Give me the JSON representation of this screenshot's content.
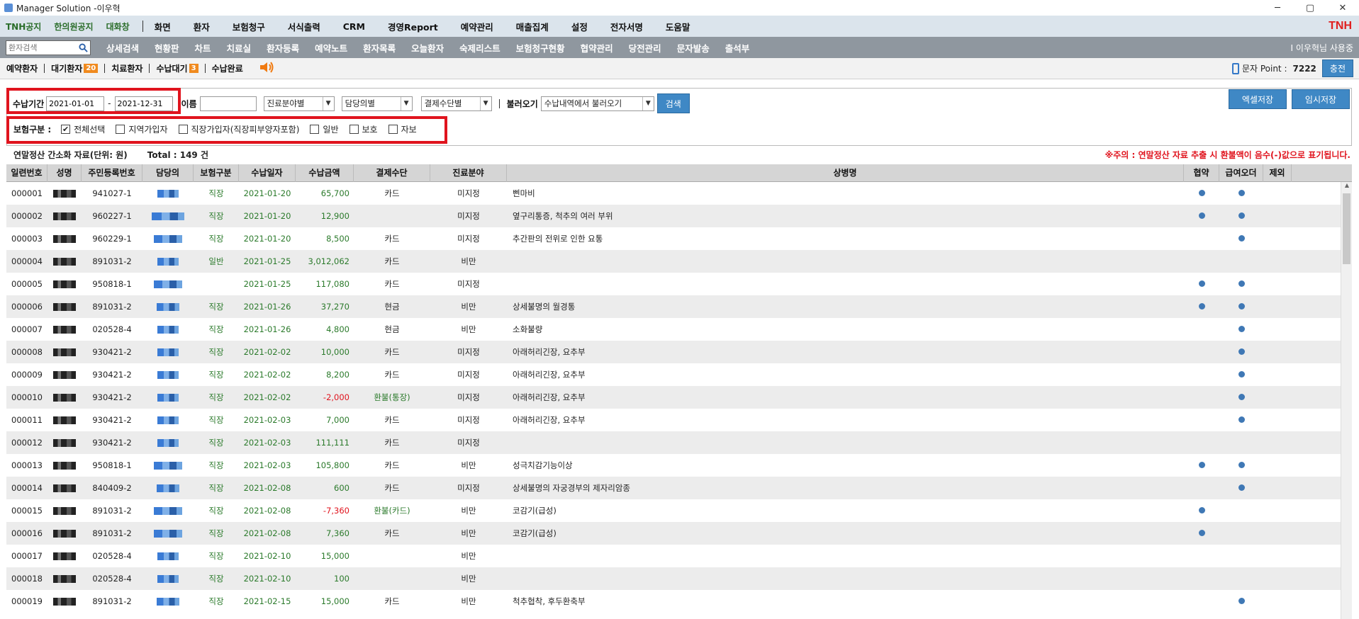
{
  "window": {
    "title": "Manager Solution -이우혁",
    "controls": [
      "─",
      "▢",
      "✕"
    ]
  },
  "menubar": {
    "notices": [
      "TNH공지",
      "한의원공지",
      "대화창"
    ],
    "menus": [
      "화면",
      "환자",
      "보험청구",
      "서식출력",
      "CRM",
      "경영Report",
      "예약관리",
      "매출집계",
      "설정",
      "전자서명",
      "도움말"
    ],
    "brand": "TNH",
    "brand_color": "#e02020"
  },
  "navbar": {
    "search_placeholder": "환자검색",
    "items": [
      "상세검색",
      "현황판",
      "차트",
      "치료실",
      "환자등록",
      "예약노트",
      "환자목록",
      "오늘환자",
      "숙제리스트",
      "보험청구현황",
      "협약관리",
      "당전관리",
      "문자발송",
      "출석부"
    ],
    "user": "I 이우혁님 사용중"
  },
  "statusbar": {
    "items": [
      {
        "label": "예약환자"
      },
      {
        "label": "대기환자",
        "badge": "20"
      },
      {
        "label": "치료환자"
      },
      {
        "label": "수납대기",
        "badge": "3"
      },
      {
        "label": "수납완료"
      }
    ],
    "point_label": "문자 Point :",
    "point_value": "7222",
    "charge_label": "충전"
  },
  "filters": {
    "period_label": "수납기간",
    "date_from": "2021-01-01",
    "date_sep": "-",
    "date_to": "2021-12-31",
    "name_label": "이름",
    "name_value": "",
    "select_dept": "진료분야별",
    "select_doctor": "담당의별",
    "select_payment": "결제수단별",
    "load_label": "불러오기",
    "select_load": "수납내역에서 불러오기",
    "search_btn": "검색",
    "excel_btn": "엑셀저장",
    "temp_btn": "임시저장",
    "insurance_label": "보험구분 :",
    "checkboxes": [
      {
        "label": "전체선택",
        "checked": true
      },
      {
        "label": "지역가입자",
        "checked": false
      },
      {
        "label": "직장가입자(직장피부양자포함)",
        "checked": false
      },
      {
        "label": "일반",
        "checked": false
      },
      {
        "label": "보호",
        "checked": false
      },
      {
        "label": "자보",
        "checked": false
      }
    ]
  },
  "info": {
    "title": "연말정산 간소화 자료(단위: 원)",
    "total": "Total : 149 건",
    "warning": "※주의 : 연말정산 자료 추출 시 환불액이 음수(-)값으로 표기됩니다."
  },
  "table": {
    "headers": [
      "일련번호",
      "성명",
      "주민등록번호",
      "담당의",
      "보험구분",
      "수납일자",
      "수납금액",
      "결제수단",
      "진료분야",
      "상병명",
      "협약",
      "급여오더",
      "제외"
    ],
    "rows": [
      {
        "no": "000001",
        "rrn": "941027-1",
        "doc_w": 30,
        "ins": "직장",
        "date": "2021-01-20",
        "amt": "65,700",
        "neg": false,
        "pay": "카드",
        "field": "미지정",
        "dx": "삔마비",
        "a": true,
        "b": true
      },
      {
        "no": "000002",
        "rrn": "960227-1",
        "doc_w": 46,
        "ins": "직장",
        "date": "2021-01-20",
        "amt": "12,900",
        "neg": false,
        "pay": "",
        "field": "미지정",
        "dx": "옆구리통증, 척추의 여러 부위",
        "a": true,
        "b": true
      },
      {
        "no": "000003",
        "rrn": "960229-1",
        "doc_w": 40,
        "ins": "직장",
        "date": "2021-01-20",
        "amt": "8,500",
        "neg": false,
        "pay": "카드",
        "field": "미지정",
        "dx": "추간판의 전위로 인한 요통",
        "a": false,
        "b": true
      },
      {
        "no": "000004",
        "rrn": "891031-2",
        "doc_w": 30,
        "ins": "일반",
        "date": "2021-01-25",
        "amt": "3,012,062",
        "neg": false,
        "pay": "카드",
        "field": "비만",
        "dx": "",
        "a": false,
        "b": false
      },
      {
        "no": "000005",
        "rrn": "950818-1",
        "doc_w": 40,
        "ins": "",
        "date": "2021-01-25",
        "amt": "117,080",
        "neg": false,
        "pay": "카드",
        "field": "미지정",
        "dx": "",
        "a": true,
        "b": true
      },
      {
        "no": "000006",
        "rrn": "891031-2",
        "doc_w": 32,
        "ins": "직장",
        "date": "2021-01-26",
        "amt": "37,270",
        "neg": false,
        "pay": "현금",
        "field": "비만",
        "dx": "상세불명의 월경통",
        "a": true,
        "b": true
      },
      {
        "no": "000007",
        "rrn": "020528-4",
        "doc_w": 30,
        "ins": "직장",
        "date": "2021-01-26",
        "amt": "4,800",
        "neg": false,
        "pay": "현금",
        "field": "비만",
        "dx": "소화불량",
        "a": false,
        "b": true
      },
      {
        "no": "000008",
        "rrn": "930421-2",
        "doc_w": 30,
        "ins": "직장",
        "date": "2021-02-02",
        "amt": "10,000",
        "neg": false,
        "pay": "카드",
        "field": "미지정",
        "dx": "아래허리긴장, 요추부",
        "a": false,
        "b": true
      },
      {
        "no": "000009",
        "rrn": "930421-2",
        "doc_w": 30,
        "ins": "직장",
        "date": "2021-02-02",
        "amt": "8,200",
        "neg": false,
        "pay": "카드",
        "field": "미지정",
        "dx": "아래허리긴장, 요추부",
        "a": false,
        "b": true
      },
      {
        "no": "000010",
        "rrn": "930421-2",
        "doc_w": 30,
        "ins": "직장",
        "date": "2021-02-02",
        "amt": "-2,000",
        "neg": true,
        "pay": "환불(통장)",
        "field": "미지정",
        "dx": "아래허리긴장, 요추부",
        "a": false,
        "b": true
      },
      {
        "no": "000011",
        "rrn": "930421-2",
        "doc_w": 30,
        "ins": "직장",
        "date": "2021-02-03",
        "amt": "7,000",
        "neg": false,
        "pay": "카드",
        "field": "미지정",
        "dx": "아래허리긴장, 요추부",
        "a": false,
        "b": true
      },
      {
        "no": "000012",
        "rrn": "930421-2",
        "doc_w": 30,
        "ins": "직장",
        "date": "2021-02-03",
        "amt": "111,111",
        "neg": false,
        "pay": "카드",
        "field": "미지정",
        "dx": "",
        "a": false,
        "b": false
      },
      {
        "no": "000013",
        "rrn": "950818-1",
        "doc_w": 40,
        "ins": "직장",
        "date": "2021-02-03",
        "amt": "105,800",
        "neg": false,
        "pay": "카드",
        "field": "비만",
        "dx": "성극치감기능이상",
        "a": true,
        "b": true
      },
      {
        "no": "000014",
        "rrn": "840409-2",
        "doc_w": 32,
        "ins": "직장",
        "date": "2021-02-08",
        "amt": "600",
        "neg": false,
        "pay": "카드",
        "field": "미지정",
        "dx": "상세불명의 자궁경부의 제자리암종",
        "a": false,
        "b": true
      },
      {
        "no": "000015",
        "rrn": "891031-2",
        "doc_w": 40,
        "ins": "직장",
        "date": "2021-02-08",
        "amt": "-7,360",
        "neg": true,
        "pay": "환불(카드)",
        "field": "비만",
        "dx": "코감기(급성)",
        "a": true,
        "b": false
      },
      {
        "no": "000016",
        "rrn": "891031-2",
        "doc_w": 40,
        "ins": "직장",
        "date": "2021-02-08",
        "amt": "7,360",
        "neg": false,
        "pay": "카드",
        "field": "비만",
        "dx": "코감기(급성)",
        "a": true,
        "b": false
      },
      {
        "no": "000017",
        "rrn": "020528-4",
        "doc_w": 30,
        "ins": "직장",
        "date": "2021-02-10",
        "amt": "15,000",
        "neg": false,
        "pay": "",
        "field": "비만",
        "dx": "",
        "a": false,
        "b": false
      },
      {
        "no": "000018",
        "rrn": "020528-4",
        "doc_w": 30,
        "ins": "직장",
        "date": "2021-02-10",
        "amt": "100",
        "neg": false,
        "pay": "",
        "field": "비만",
        "dx": "",
        "a": false,
        "b": false
      },
      {
        "no": "000019",
        "rrn": "891031-2",
        "doc_w": 32,
        "ins": "직장",
        "date": "2021-02-15",
        "amt": "15,000",
        "neg": false,
        "pay": "카드",
        "field": "비만",
        "dx": "척추협착, 후두환축부",
        "a": false,
        "b": true
      }
    ]
  },
  "colors": {
    "accent": "#3f88c5",
    "highlight_box": "#e0141e",
    "green_text": "#2b7a2b",
    "negative": "#e0141e"
  }
}
